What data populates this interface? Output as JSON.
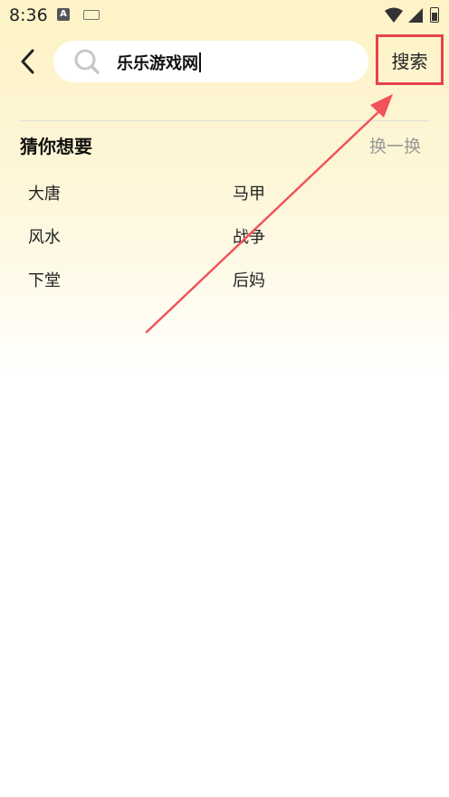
{
  "status_bar": {
    "time": "8:36",
    "notification_letter": "A"
  },
  "search": {
    "query": "乐乐游戏网",
    "button_label": "搜索"
  },
  "suggestions": {
    "title": "猜你想要",
    "refresh_label": "换一换",
    "items": [
      "大唐",
      "马甲",
      "风水",
      "战争",
      "下堂",
      "后妈"
    ]
  },
  "annotation": {
    "highlight_color": "#e8434a"
  }
}
